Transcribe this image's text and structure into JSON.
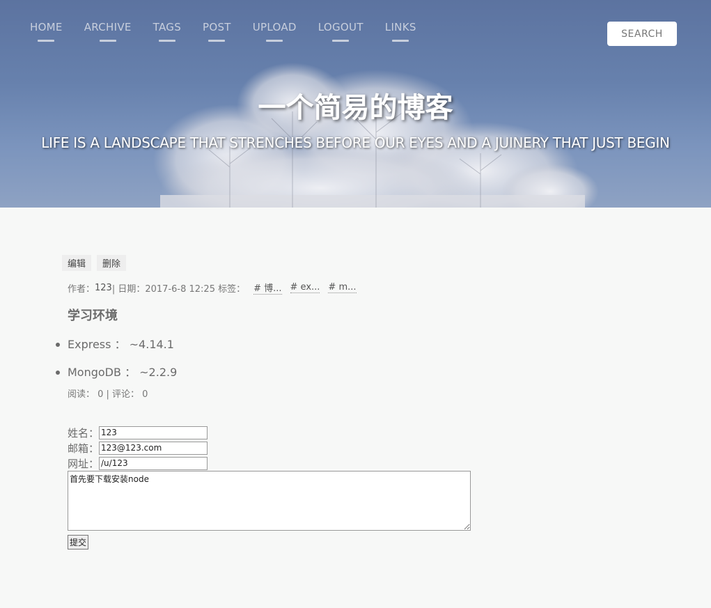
{
  "nav": {
    "items": [
      {
        "label": "HOME"
      },
      {
        "label": "ARCHIVE"
      },
      {
        "label": "TAGS"
      },
      {
        "label": "POST"
      },
      {
        "label": "UPLOAD"
      },
      {
        "label": "LOGOUT"
      },
      {
        "label": "LINKS"
      }
    ],
    "search_label": "SEARCH"
  },
  "hero": {
    "title": "一个简易的博客",
    "subtitle": "LIFE IS A LANDSCAPE THAT STRENCHES BEFORE OUR EYES AND A JUINERY THAT JUST BEGIN"
  },
  "post": {
    "actions": {
      "edit": "编辑",
      "delete": "删除"
    },
    "meta": {
      "author_label": "作者：",
      "author": "123",
      "date_label": " | 日期：2017-6-8 12:25 标签：",
      "tags": [
        "# 博...",
        "# ex...",
        "# m..."
      ]
    },
    "title": "学习环境",
    "items": [
      "Express ： ~4.14.1",
      "MongoDB ： ~2.2.9"
    ],
    "stats": "阅读： 0 | 评论： 0"
  },
  "comment_form": {
    "name_label": "姓名：",
    "name_value": "123",
    "email_label": "邮箱：",
    "email_value": "123@123.com",
    "url_label": "网址：",
    "url_value": "/u/123",
    "content_value": "首先要下载安装node",
    "submit_label": "提交"
  }
}
